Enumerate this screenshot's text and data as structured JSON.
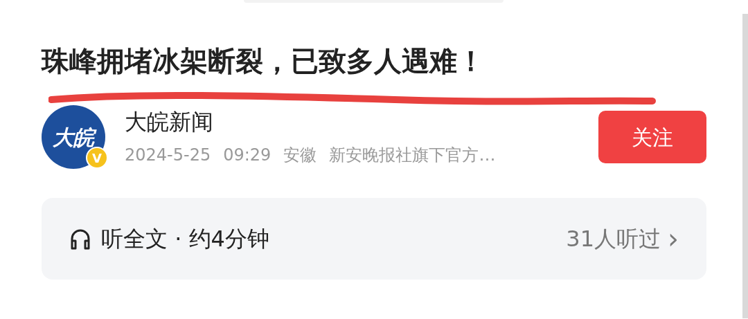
{
  "article": {
    "title": "珠峰拥堵冰架断裂，已致多人遇难！"
  },
  "author": {
    "avatar_text": "大皖",
    "badge": "V",
    "name": "大皖新闻",
    "date": "2024-5-25",
    "time": "09:29",
    "location": "安徽",
    "description": "新安晚报社旗下官方…"
  },
  "follow_button": {
    "label": "关注"
  },
  "listen_bar": {
    "label": "听全文 · 约4分钟",
    "listeners": "31人听过",
    "chevron": "›"
  }
}
